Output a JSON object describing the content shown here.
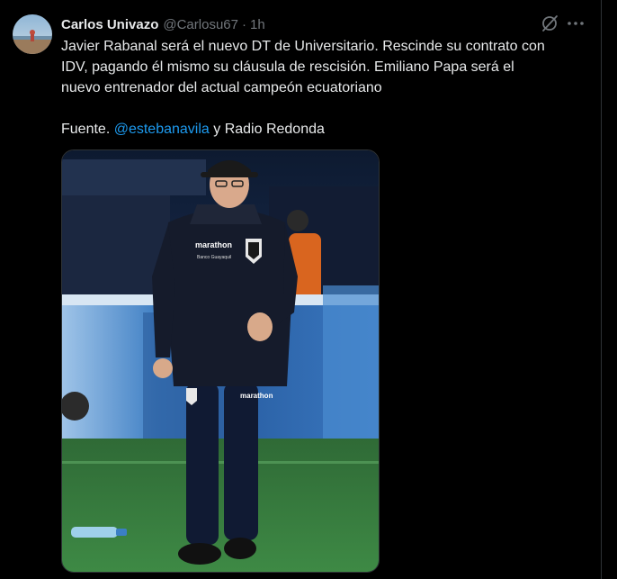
{
  "tweet": {
    "display_name": "Carlos Univazo",
    "handle": "@Carlosu67",
    "separator": "·",
    "time": "1h",
    "text": {
      "paragraph_lines": [
        "Javier Rabanal será el nuevo DT de Universitario. Rescinde su contrato con",
        "IDV, pagando él mismo su cláusula de rescisión. Emiliano Papa será el",
        "nuevo entrenador del actual campeón ecuatoriano"
      ],
      "source_prefix": "Fuente. ",
      "source_mention": "@estebanavila",
      "source_suffix": " y Radio Redonda"
    },
    "media": {
      "shirt_sponsor": "marathon",
      "chest_sponsor_small": "Banco Guayaquil",
      "shorts_sponsor": "marathon"
    },
    "icons": {
      "grok": "grok-icon",
      "more": "more-icon"
    }
  },
  "colors": {
    "background": "#000000",
    "text_primary": "#e7e9ea",
    "text_secondary": "#71767b",
    "link": "#1d9bf0",
    "border": "#2f3336"
  }
}
